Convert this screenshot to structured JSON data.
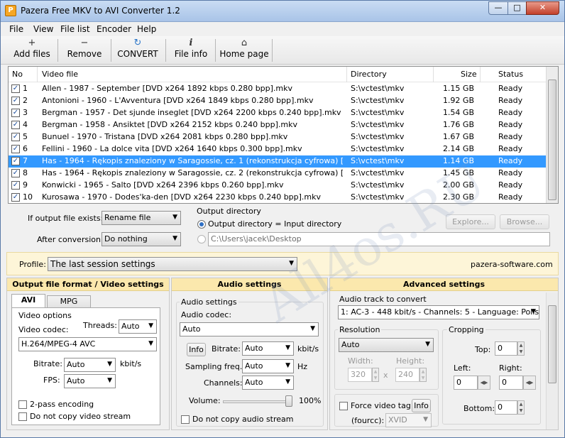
{
  "window": {
    "title": "Pazera Free MKV to AVI Converter 1.2",
    "min_glyph": "—",
    "max_glyph": "□",
    "close_glyph": "✕"
  },
  "menu": [
    "File",
    "View",
    "File list",
    "Encoder",
    "Help"
  ],
  "toolbar": [
    {
      "label": "Add files",
      "icon": "plus-icon",
      "glyph": "+"
    },
    {
      "label": "Remove",
      "icon": "minus-icon",
      "glyph": "−"
    },
    {
      "label": "CONVERT",
      "icon": "convert-icon",
      "glyph": "↻"
    },
    {
      "label": "File info",
      "icon": "info-icon",
      "glyph": "i"
    },
    {
      "label": "Home page",
      "icon": "home-icon",
      "glyph": "⌂"
    }
  ],
  "list": {
    "columns": [
      "No",
      "Video file",
      "Directory",
      "Size",
      "Status"
    ],
    "rows": [
      {
        "no": "1",
        "file": "Allen - 1987 - September [DVD x264 1892 kbps 0.280 bpp].mkv",
        "dir": "S:\\vctest\\mkv",
        "size": "1.15 GB",
        "status": "Ready",
        "checked": true,
        "selected": false
      },
      {
        "no": "2",
        "file": "Antonioni - 1960 - L'Avventura [DVD x264 1849 kbps 0.280 bpp].mkv",
        "dir": "S:\\vctest\\mkv",
        "size": "1.92 GB",
        "status": "Ready",
        "checked": true,
        "selected": false
      },
      {
        "no": "3",
        "file": "Bergman - 1957 - Det sjunde inseglet [DVD x264 2200 kbps 0.240 bpp].mkv",
        "dir": "S:\\vctest\\mkv",
        "size": "1.54 GB",
        "status": "Ready",
        "checked": true,
        "selected": false
      },
      {
        "no": "4",
        "file": "Bergman - 1958 - Ansiktet [DVD x264 2152 kbps 0.240 bpp].mkv",
        "dir": "S:\\vctest\\mkv",
        "size": "1.76 GB",
        "status": "Ready",
        "checked": true,
        "selected": false
      },
      {
        "no": "5",
        "file": "Bunuel - 1970 - Tristana [DVD x264 2081 kbps 0.280 bpp].mkv",
        "dir": "S:\\vctest\\mkv",
        "size": "1.67 GB",
        "status": "Ready",
        "checked": true,
        "selected": false
      },
      {
        "no": "6",
        "file": "Fellini - 1960 - La dolce vita [DVD x264 1640 kbps 0.300 bpp].mkv",
        "dir": "S:\\vctest\\mkv",
        "size": "2.14 GB",
        "status": "Ready",
        "checked": true,
        "selected": false
      },
      {
        "no": "7",
        "file": "Has - 1964 - Rękopis znaleziony w Saragossie, cz. 1 (rekonstrukcja cyfrowa) [DVD x2...",
        "dir": "S:\\vctest\\mkv",
        "size": "1.14 GB",
        "status": "Ready",
        "checked": true,
        "selected": true
      },
      {
        "no": "8",
        "file": "Has - 1964 - Rękopis znaleziony w Saragossie, cz. 2 (rekonstrukcja cyfrowa) [DVD x2...",
        "dir": "S:\\vctest\\mkv",
        "size": "1.45 GB",
        "status": "Ready",
        "checked": true,
        "selected": false
      },
      {
        "no": "9",
        "file": "Konwicki - 1965 - Salto [DVD x264 2396 kbps 0.260 bpp].mkv",
        "dir": "S:\\vctest\\mkv",
        "size": "2.00 GB",
        "status": "Ready",
        "checked": true,
        "selected": false
      },
      {
        "no": "10",
        "file": "Kurosawa - 1970 - Dodes'ka-den [DVD x264 2230 kbps 0.240 bpp].mkv",
        "dir": "S:\\vctest\\mkv",
        "size": "2.30 GB",
        "status": "Ready",
        "checked": true,
        "selected": false
      }
    ]
  },
  "output": {
    "if_exists_label": "If output file exists:",
    "if_exists_value": "Rename file",
    "after_label": "After conversion:",
    "after_value": "Do nothing",
    "dir_group_title": "Output directory",
    "radio_input_dir": "Output directory = Input directory",
    "custom_dir_value": "C:\\Users\\jacek\\Desktop",
    "explore_label": "Explore...",
    "browse_label": "Browse..."
  },
  "profile": {
    "label": "Profile:",
    "value": "The last session settings",
    "site": "pazera-software.com"
  },
  "video": {
    "header": "Output file format / Video settings",
    "tab_avi": "AVI",
    "tab_mpg": "MPG",
    "options_title": "Video options",
    "codec_label": "Video codec:",
    "codec_value": "H.264/MPEG-4 AVC",
    "threads_label": "Threads:",
    "threads_value": "Auto",
    "bitrate_label": "Bitrate:",
    "bitrate_value": "Auto",
    "bitrate_unit": "kbit/s",
    "fps_label": "FPS:",
    "fps_value": "Auto",
    "twopass_label": "2-pass encoding",
    "nocopy_label": "Do not copy video stream"
  },
  "audio": {
    "header": "Audio settings",
    "group_title": "Audio settings",
    "codec_label": "Audio codec:",
    "codec_value": "Auto",
    "info_label": "Info",
    "bitrate_label": "Bitrate:",
    "bitrate_value": "Auto",
    "bitrate_unit": "kbit/s",
    "freq_label": "Sampling freq.:",
    "freq_value": "Auto",
    "freq_unit": "Hz",
    "channels_label": "Channels:",
    "channels_value": "Auto",
    "volume_label": "Volume:",
    "volume_value": "100%",
    "volume_level": 1.0,
    "nocopy_label": "Do not copy audio stream"
  },
  "advanced": {
    "header": "Advanced settings",
    "track_title": "Audio track to convert",
    "track_value": "1: AC-3 - 448 kbit/s - Channels: 5 - Language: Polish",
    "resolution_title": "Resolution",
    "resolution_value": "Auto",
    "width_label": "Width:",
    "width_value": "320",
    "height_label": "Height:",
    "height_value": "240",
    "x_label": "x",
    "cropping_title": "Cropping",
    "top_label": "Top:",
    "top_value": "0",
    "left_label": "Left:",
    "left_value": "0",
    "right_label": "Right:",
    "right_value": "0",
    "bottom_label": "Bottom:",
    "bottom_value": "0",
    "force_tag_label": "Force video tag",
    "info_label": "Info",
    "fourcc_label": "(fourcc):",
    "fourcc_value": "XVID"
  },
  "watermark": "All4os.RU"
}
